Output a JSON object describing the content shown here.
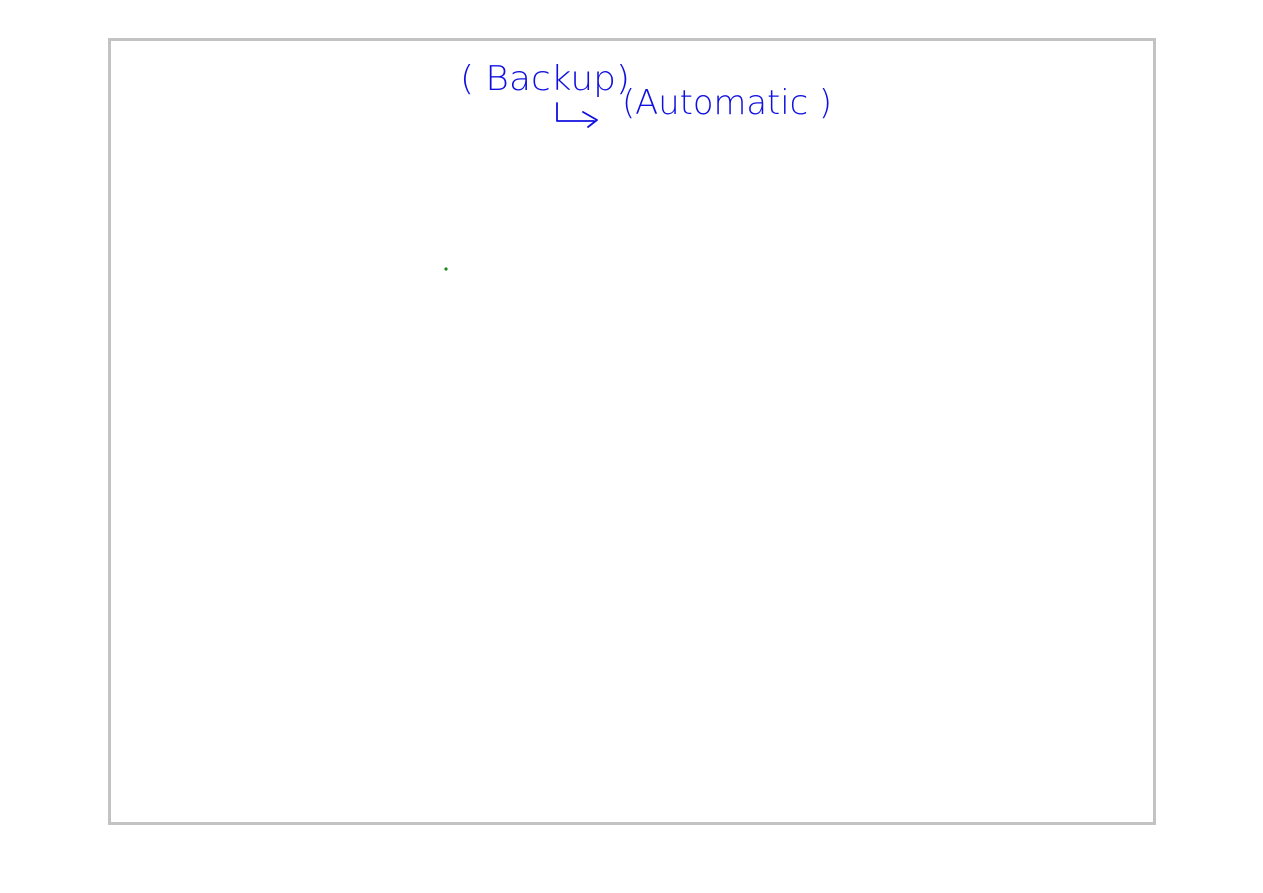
{
  "whiteboard": {
    "line1": "( Backup)",
    "line2": "(Automatic )",
    "ink_color": "#1010e0",
    "dot_color": "#1a8a1a",
    "frame_color": "#c3c3c3",
    "arrow_icon": "hooked-arrow-icon"
  }
}
